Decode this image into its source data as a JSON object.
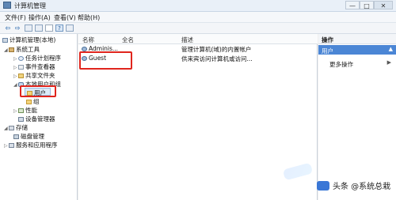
{
  "window": {
    "title": "计算机管理",
    "min": "—",
    "max": "□",
    "close": "✕"
  },
  "menu": [
    "文件(F)",
    "操作(A)",
    "查看(V)",
    "帮助(H)"
  ],
  "toolbar": {
    "back": "⇦",
    "forward": "⇨",
    "help": "?"
  },
  "tree": [
    "计算机管理(本地)",
    "系统工具",
    "任务计划程序",
    "事件查看器",
    "共享文件夹",
    "本地用户和组",
    "用户",
    "组",
    "性能",
    "设备管理器",
    "存储",
    "磁盘管理",
    "服务和应用程序"
  ],
  "columns": {
    "name": "名称",
    "fullname": "全名",
    "desc": "描述"
  },
  "rows": [
    {
      "name": "Adminis...",
      "fullname": "",
      "desc": "管理计算机(域)的内置帐户"
    },
    {
      "name": "Guest",
      "fullname": "",
      "desc": "供来宾访问计算机或访问..."
    }
  ],
  "actions": {
    "header": "操作",
    "section": "用户",
    "more": "更多操作"
  },
  "watermark": "头条 @系统总栽"
}
